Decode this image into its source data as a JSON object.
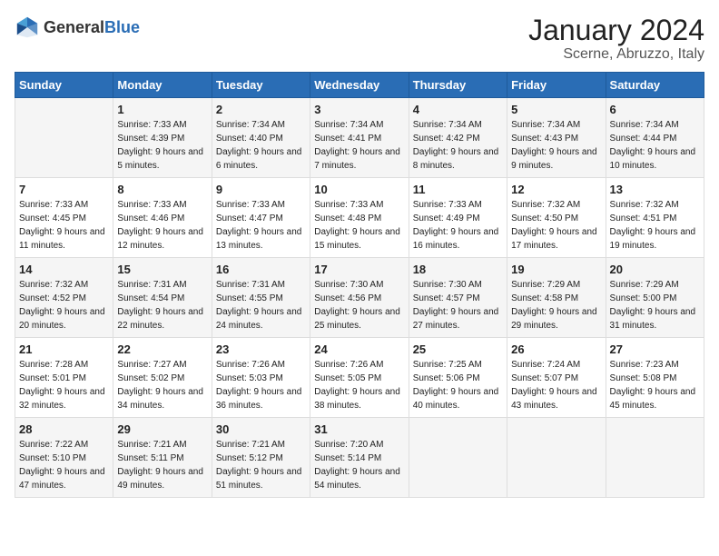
{
  "header": {
    "logo_general": "General",
    "logo_blue": "Blue",
    "month": "January 2024",
    "location": "Scerne, Abruzzo, Italy"
  },
  "days_of_week": [
    "Sunday",
    "Monday",
    "Tuesday",
    "Wednesday",
    "Thursday",
    "Friday",
    "Saturday"
  ],
  "weeks": [
    [
      {
        "day": "",
        "sunrise": "",
        "sunset": "",
        "daylight": ""
      },
      {
        "day": "1",
        "sunrise": "Sunrise: 7:33 AM",
        "sunset": "Sunset: 4:39 PM",
        "daylight": "Daylight: 9 hours and 5 minutes."
      },
      {
        "day": "2",
        "sunrise": "Sunrise: 7:34 AM",
        "sunset": "Sunset: 4:40 PM",
        "daylight": "Daylight: 9 hours and 6 minutes."
      },
      {
        "day": "3",
        "sunrise": "Sunrise: 7:34 AM",
        "sunset": "Sunset: 4:41 PM",
        "daylight": "Daylight: 9 hours and 7 minutes."
      },
      {
        "day": "4",
        "sunrise": "Sunrise: 7:34 AM",
        "sunset": "Sunset: 4:42 PM",
        "daylight": "Daylight: 9 hours and 8 minutes."
      },
      {
        "day": "5",
        "sunrise": "Sunrise: 7:34 AM",
        "sunset": "Sunset: 4:43 PM",
        "daylight": "Daylight: 9 hours and 9 minutes."
      },
      {
        "day": "6",
        "sunrise": "Sunrise: 7:34 AM",
        "sunset": "Sunset: 4:44 PM",
        "daylight": "Daylight: 9 hours and 10 minutes."
      }
    ],
    [
      {
        "day": "7",
        "sunrise": "Sunrise: 7:33 AM",
        "sunset": "Sunset: 4:45 PM",
        "daylight": "Daylight: 9 hours and 11 minutes."
      },
      {
        "day": "8",
        "sunrise": "Sunrise: 7:33 AM",
        "sunset": "Sunset: 4:46 PM",
        "daylight": "Daylight: 9 hours and 12 minutes."
      },
      {
        "day": "9",
        "sunrise": "Sunrise: 7:33 AM",
        "sunset": "Sunset: 4:47 PM",
        "daylight": "Daylight: 9 hours and 13 minutes."
      },
      {
        "day": "10",
        "sunrise": "Sunrise: 7:33 AM",
        "sunset": "Sunset: 4:48 PM",
        "daylight": "Daylight: 9 hours and 15 minutes."
      },
      {
        "day": "11",
        "sunrise": "Sunrise: 7:33 AM",
        "sunset": "Sunset: 4:49 PM",
        "daylight": "Daylight: 9 hours and 16 minutes."
      },
      {
        "day": "12",
        "sunrise": "Sunrise: 7:32 AM",
        "sunset": "Sunset: 4:50 PM",
        "daylight": "Daylight: 9 hours and 17 minutes."
      },
      {
        "day": "13",
        "sunrise": "Sunrise: 7:32 AM",
        "sunset": "Sunset: 4:51 PM",
        "daylight": "Daylight: 9 hours and 19 minutes."
      }
    ],
    [
      {
        "day": "14",
        "sunrise": "Sunrise: 7:32 AM",
        "sunset": "Sunset: 4:52 PM",
        "daylight": "Daylight: 9 hours and 20 minutes."
      },
      {
        "day": "15",
        "sunrise": "Sunrise: 7:31 AM",
        "sunset": "Sunset: 4:54 PM",
        "daylight": "Daylight: 9 hours and 22 minutes."
      },
      {
        "day": "16",
        "sunrise": "Sunrise: 7:31 AM",
        "sunset": "Sunset: 4:55 PM",
        "daylight": "Daylight: 9 hours and 24 minutes."
      },
      {
        "day": "17",
        "sunrise": "Sunrise: 7:30 AM",
        "sunset": "Sunset: 4:56 PM",
        "daylight": "Daylight: 9 hours and 25 minutes."
      },
      {
        "day": "18",
        "sunrise": "Sunrise: 7:30 AM",
        "sunset": "Sunset: 4:57 PM",
        "daylight": "Daylight: 9 hours and 27 minutes."
      },
      {
        "day": "19",
        "sunrise": "Sunrise: 7:29 AM",
        "sunset": "Sunset: 4:58 PM",
        "daylight": "Daylight: 9 hours and 29 minutes."
      },
      {
        "day": "20",
        "sunrise": "Sunrise: 7:29 AM",
        "sunset": "Sunset: 5:00 PM",
        "daylight": "Daylight: 9 hours and 31 minutes."
      }
    ],
    [
      {
        "day": "21",
        "sunrise": "Sunrise: 7:28 AM",
        "sunset": "Sunset: 5:01 PM",
        "daylight": "Daylight: 9 hours and 32 minutes."
      },
      {
        "day": "22",
        "sunrise": "Sunrise: 7:27 AM",
        "sunset": "Sunset: 5:02 PM",
        "daylight": "Daylight: 9 hours and 34 minutes."
      },
      {
        "day": "23",
        "sunrise": "Sunrise: 7:26 AM",
        "sunset": "Sunset: 5:03 PM",
        "daylight": "Daylight: 9 hours and 36 minutes."
      },
      {
        "day": "24",
        "sunrise": "Sunrise: 7:26 AM",
        "sunset": "Sunset: 5:05 PM",
        "daylight": "Daylight: 9 hours and 38 minutes."
      },
      {
        "day": "25",
        "sunrise": "Sunrise: 7:25 AM",
        "sunset": "Sunset: 5:06 PM",
        "daylight": "Daylight: 9 hours and 40 minutes."
      },
      {
        "day": "26",
        "sunrise": "Sunrise: 7:24 AM",
        "sunset": "Sunset: 5:07 PM",
        "daylight": "Daylight: 9 hours and 43 minutes."
      },
      {
        "day": "27",
        "sunrise": "Sunrise: 7:23 AM",
        "sunset": "Sunset: 5:08 PM",
        "daylight": "Daylight: 9 hours and 45 minutes."
      }
    ],
    [
      {
        "day": "28",
        "sunrise": "Sunrise: 7:22 AM",
        "sunset": "Sunset: 5:10 PM",
        "daylight": "Daylight: 9 hours and 47 minutes."
      },
      {
        "day": "29",
        "sunrise": "Sunrise: 7:21 AM",
        "sunset": "Sunset: 5:11 PM",
        "daylight": "Daylight: 9 hours and 49 minutes."
      },
      {
        "day": "30",
        "sunrise": "Sunrise: 7:21 AM",
        "sunset": "Sunset: 5:12 PM",
        "daylight": "Daylight: 9 hours and 51 minutes."
      },
      {
        "day": "31",
        "sunrise": "Sunrise: 7:20 AM",
        "sunset": "Sunset: 5:14 PM",
        "daylight": "Daylight: 9 hours and 54 minutes."
      },
      {
        "day": "",
        "sunrise": "",
        "sunset": "",
        "daylight": ""
      },
      {
        "day": "",
        "sunrise": "",
        "sunset": "",
        "daylight": ""
      },
      {
        "day": "",
        "sunrise": "",
        "sunset": "",
        "daylight": ""
      }
    ]
  ]
}
